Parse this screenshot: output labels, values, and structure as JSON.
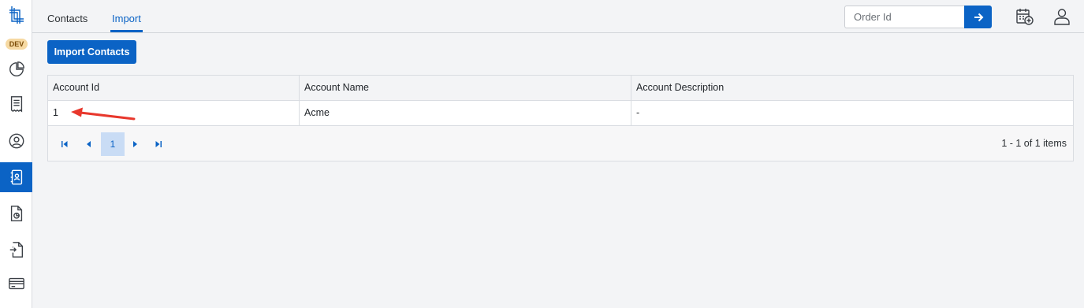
{
  "sidebar": {
    "env_badge": "DEV",
    "items": [
      {
        "name": "dashboard",
        "icon": "pie-chart-icon",
        "active": false
      },
      {
        "name": "orders",
        "icon": "receipt-icon",
        "active": false
      },
      {
        "name": "users",
        "icon": "user-circle-icon",
        "active": false
      },
      {
        "name": "contacts",
        "icon": "contacts-book-icon",
        "active": true
      },
      {
        "name": "reports",
        "icon": "report-document-icon",
        "active": false
      },
      {
        "name": "import-export",
        "icon": "file-import-icon",
        "active": false
      },
      {
        "name": "billing",
        "icon": "credit-card-icon",
        "active": false
      }
    ]
  },
  "header": {
    "tabs": [
      {
        "label": "Contacts",
        "active": false
      },
      {
        "label": "Import",
        "active": true
      }
    ],
    "search": {
      "placeholder": "Order Id",
      "value": ""
    },
    "search_button_icon": "arrow-right-icon",
    "icons": [
      "calendar-add-icon",
      "user-profile-icon"
    ]
  },
  "main": {
    "import_button_label": "Import Contacts",
    "table": {
      "columns": [
        "Account Id",
        "Account Name",
        "Account Description"
      ],
      "rows": [
        [
          "1",
          "Acme",
          "-"
        ]
      ]
    },
    "pager": {
      "current_page": "1",
      "items_label": "1 - 1 of 1 items"
    }
  },
  "colors": {
    "accent": "#0b63c5",
    "annotation_arrow": "#e8372c",
    "badge_bg": "#f6d9a2"
  }
}
